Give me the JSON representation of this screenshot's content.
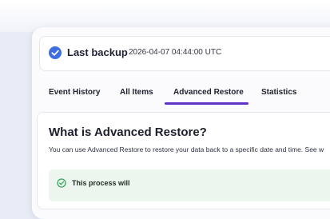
{
  "backup": {
    "title": "Last backup",
    "timestamp": "2026-04-07 04:44:00 UTC"
  },
  "tabs": [
    {
      "label": "Event History",
      "active": false
    },
    {
      "label": "All Items",
      "active": false
    },
    {
      "label": "Advanced Restore",
      "active": true
    },
    {
      "label": "Statistics",
      "active": false
    }
  ],
  "content": {
    "title": "What is Advanced Restore?",
    "description": "You can use Advanced Restore to restore your data back to a specific date and time. See w",
    "process_label": "This process will"
  },
  "colors": {
    "accent": "#5e31c8",
    "check_blue": "#3d6fe3",
    "success_green": "#3aa85a",
    "success_bg": "#ecf6ef"
  },
  "icons": {
    "backup_status": "check-circle-icon",
    "process": "check-outline-icon"
  }
}
